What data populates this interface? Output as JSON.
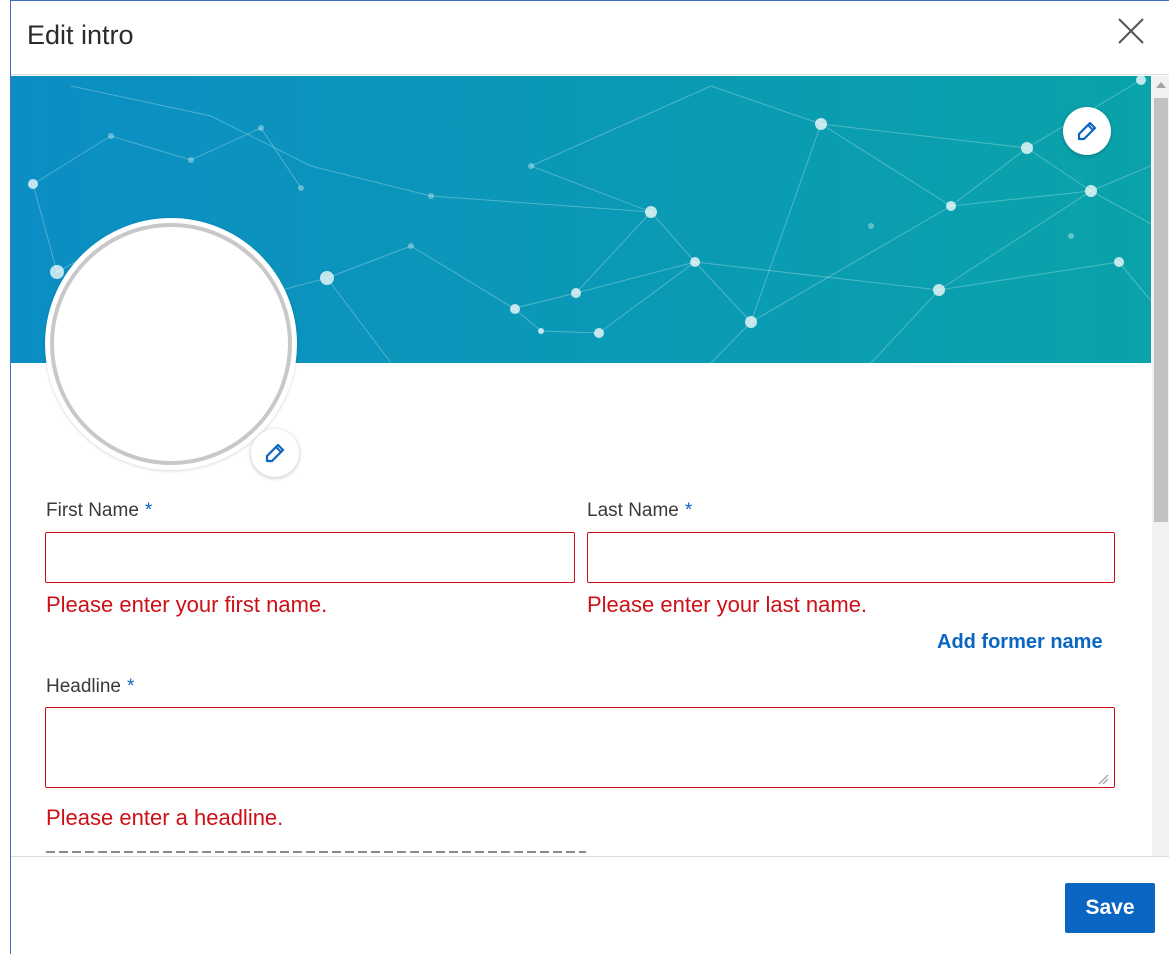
{
  "dialog": {
    "title": "Edit intro",
    "close_icon": "close-icon"
  },
  "banner": {
    "colors": {
      "left": "#0b8ec4",
      "right": "#0aa3a9"
    },
    "edit_icon": "pencil-icon"
  },
  "avatar": {
    "edit_icon": "pencil-icon"
  },
  "form": {
    "first_name": {
      "label": "First Name",
      "required_marker": "*",
      "value": "",
      "error": "Please enter your first name."
    },
    "last_name": {
      "label": "Last Name",
      "required_marker": "*",
      "value": "",
      "error": "Please enter your last name."
    },
    "add_former_name": "Add former name",
    "headline": {
      "label": "Headline",
      "required_marker": "*",
      "value": "",
      "error": "Please enter a headline."
    }
  },
  "footer": {
    "save_label": "Save"
  },
  "colors": {
    "accent": "#0a66c2",
    "error": "#cc1016",
    "modal_border": "#3f6fc0"
  }
}
